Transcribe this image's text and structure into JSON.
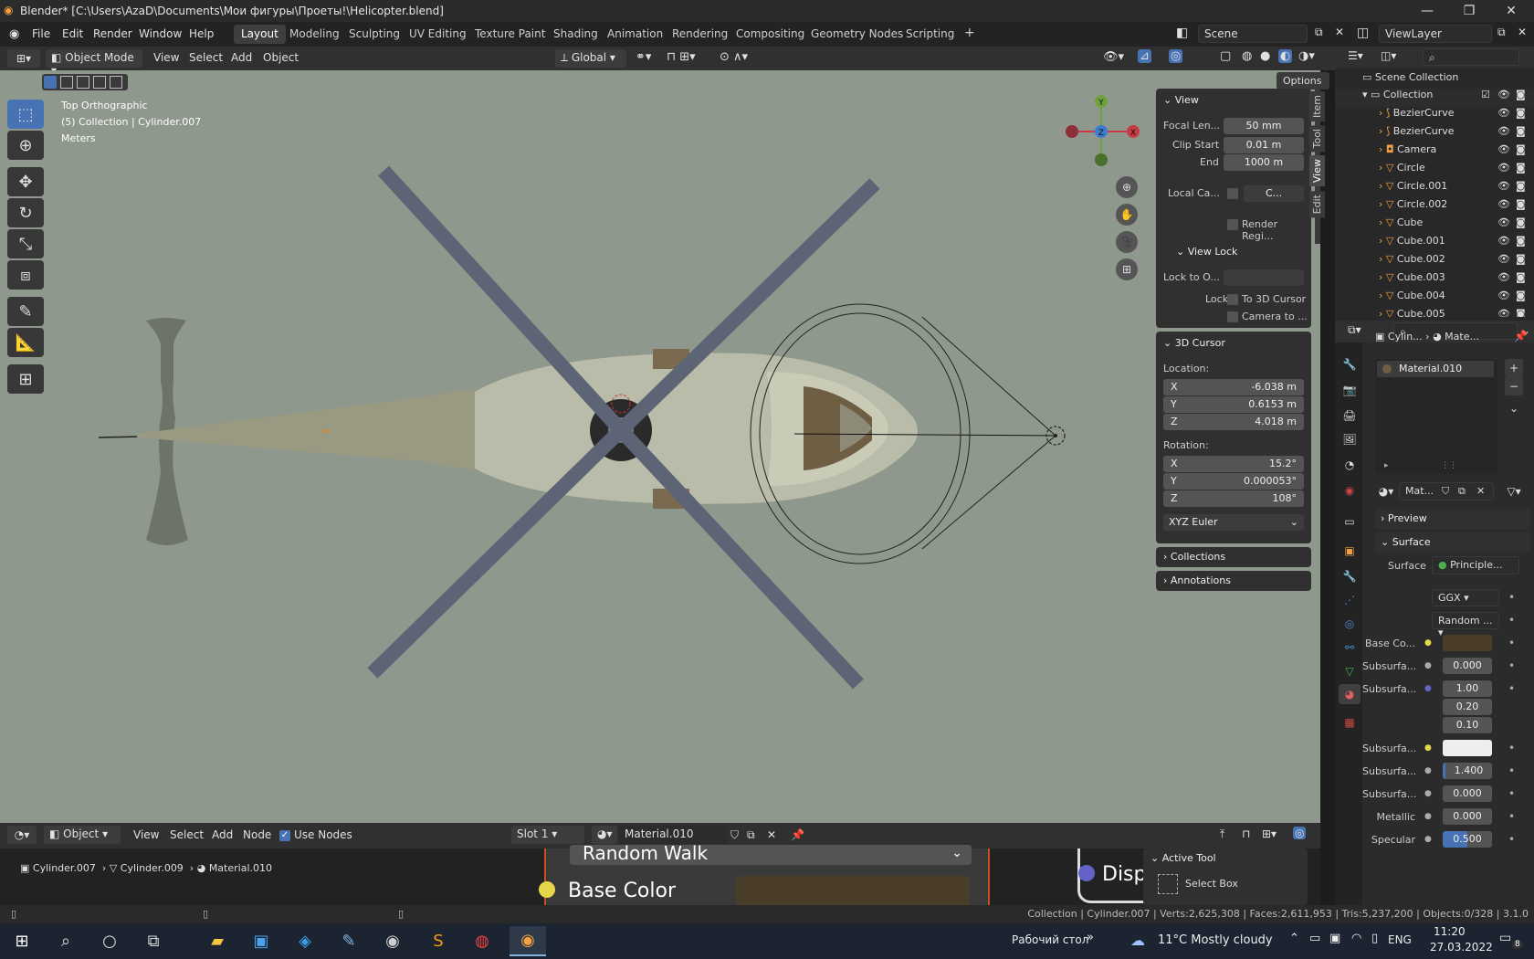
{
  "window": {
    "title": "Blender* [C:\\Users\\AzaD\\Documents\\Мои фигуры\\Проеты!\\Helicopter.blend]"
  },
  "menu": {
    "file": "File",
    "edit": "Edit",
    "render": "Render",
    "window": "Window",
    "help": "Help"
  },
  "workspaces": [
    "Layout",
    "Modeling",
    "Sculpting",
    "UV Editing",
    "Texture Paint",
    "Shading",
    "Animation",
    "Rendering",
    "Compositing",
    "Geometry Nodes",
    "Scripting"
  ],
  "scene": {
    "name": "Scene",
    "view_layer": "ViewLayer"
  },
  "header": {
    "mode": "Object Mode",
    "view": "View",
    "select": "Select",
    "add": "Add",
    "object": "Object",
    "orientation": "Global",
    "options": "Options"
  },
  "viewport": {
    "view_name": "Top Orthographic",
    "collection_info": "(5) Collection | Cylinder.007",
    "units": "Meters"
  },
  "gizmo": {
    "y": "Y",
    "z": "Z",
    "x": "X"
  },
  "npanel": {
    "tabs": [
      "Item",
      "Tool",
      "View",
      "Edit"
    ],
    "view": {
      "title": "View",
      "focal_label": "Focal Len...",
      "focal": "50 mm",
      "clip_start_label": "Clip Start",
      "clip_start": "0.01 m",
      "end_label": "End",
      "end": "1000 m",
      "local_cam_label": "Local Ca...",
      "local_cam_value": "C...",
      "render_region": "Render Regi..."
    },
    "view_lock": {
      "title": "View Lock",
      "lock_to_label": "Lock to O...",
      "lock_label": "Lock",
      "to_cursor": "To 3D Cursor",
      "camera_to": "Camera to ..."
    },
    "cursor": {
      "title": "3D Cursor",
      "location_label": "Location:",
      "x_label": "X",
      "x": "-6.038 m",
      "y_label": "Y",
      "y": "0.6153 m",
      "z_label": "Z",
      "z": "4.018 m",
      "rotation_label": "Rotation:",
      "rx": "15.2°",
      "ry": "0.000053°",
      "rz": "108°",
      "mode": "XYZ Euler"
    },
    "collections": "Collections",
    "annotations": "Annotations"
  },
  "outliner": {
    "root": "Scene Collection",
    "collection": "Collection",
    "items": [
      "BezierCurve",
      "BezierCurve",
      "Camera",
      "Circle",
      "Circle.001",
      "Circle.002",
      "Cube",
      "Cube.001",
      "Cube.002",
      "Cube.003",
      "Cube.004",
      "Cube.005"
    ]
  },
  "properties": {
    "breadcrumb_obj": "Cylin...",
    "breadcrumb_mat": "Mate...",
    "slot_material": "Material.010",
    "mat_short": "Mat...",
    "preview": "Preview",
    "surface_section": "Surface",
    "surface_label": "Surface",
    "surface_value": "Principle...",
    "distribution": "GGX",
    "sss_method": "Random ...",
    "rows": [
      {
        "label": "Base Co...",
        "value": ""
      },
      {
        "label": "Subsurfa...",
        "value": "0.000"
      },
      {
        "label": "Subsurfa...",
        "value": "1.00"
      },
      {
        "label": "",
        "value": "0.20"
      },
      {
        "label": "",
        "value": "0.10"
      },
      {
        "label": "Subsurfa...",
        "value": ""
      },
      {
        "label": "Subsurfa...",
        "value": "1.400"
      },
      {
        "label": "Subsurfa...",
        "value": "0.000"
      },
      {
        "label": "Metallic",
        "value": "0.000"
      },
      {
        "label": "Specular",
        "value": "0.500"
      }
    ]
  },
  "node_editor": {
    "object": "Object",
    "view": "View",
    "select": "Select",
    "add": "Add",
    "node": "Node",
    "use_nodes": "Use Nodes",
    "slot": "Slot 1",
    "material": "Material.010",
    "breadcrumb": [
      "Cylinder.007",
      "Cylinder.009",
      "Material.010"
    ],
    "random_walk": "Random Walk",
    "base_color": "Base Color",
    "disp": "Disp",
    "active_tool": "Active Tool",
    "select_box": "Select Box"
  },
  "status": {
    "text": "Collection | Cylinder.007 | Verts:2,625,308 | Faces:2,611,953 | Tris:5,237,200 | Objects:0/328 | 3.1.0"
  },
  "taskbar": {
    "desktop": "Рабочий стол",
    "weather": "11°C  Mostly cloudy",
    "lang": "ENG",
    "time": "11:20",
    "date": "27.03.2022",
    "notif": "8"
  },
  "colors": {
    "accent": "#4772b3",
    "viewport_bg": "#8f988c",
    "panel": "#303030"
  }
}
